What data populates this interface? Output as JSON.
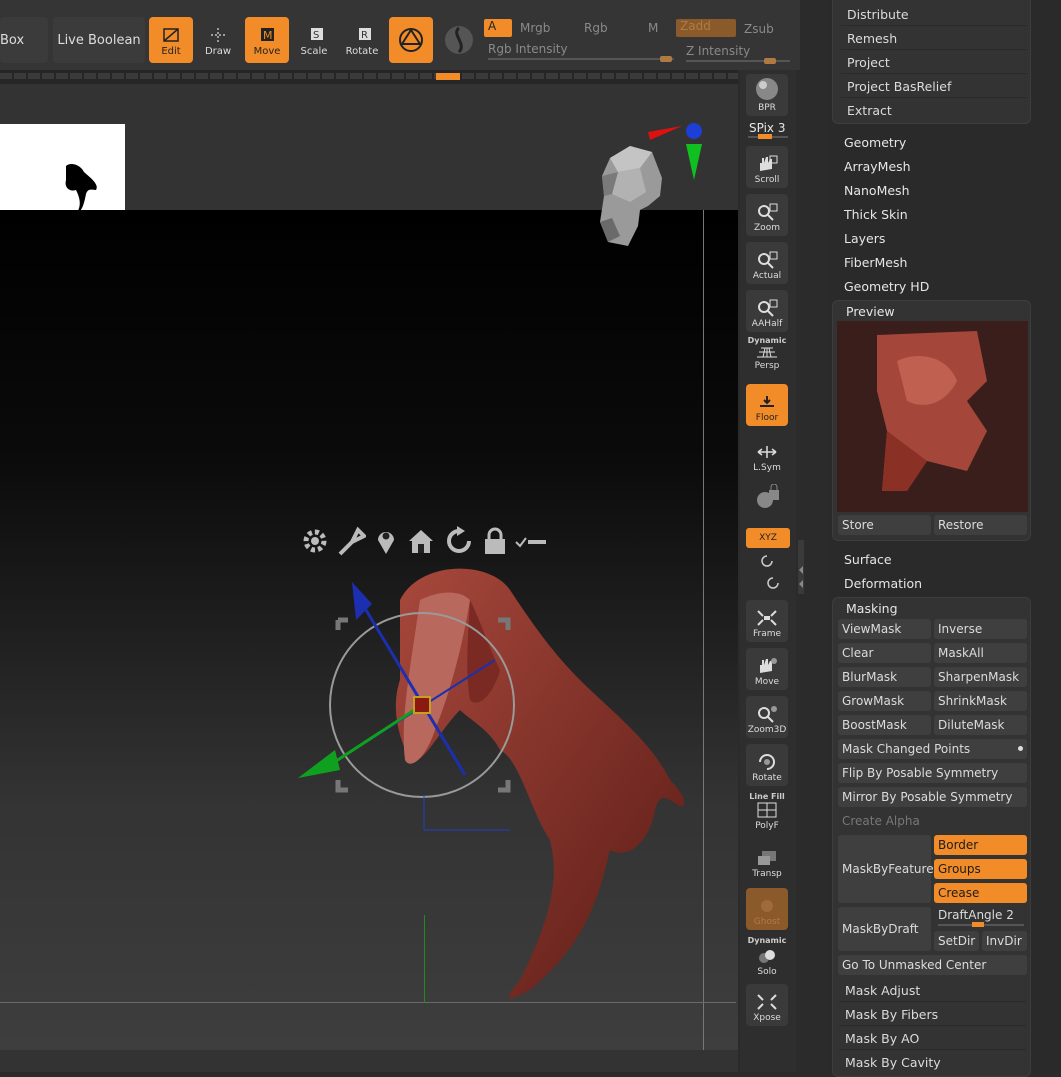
{
  "toolbar": {
    "box_label": "Box",
    "live_boolean_label": "Live Boolean",
    "tools": [
      {
        "label": "Edit",
        "active": true
      },
      {
        "label": "Draw",
        "active": false
      },
      {
        "label": "Move",
        "active": true
      },
      {
        "label": "Scale",
        "active": false
      },
      {
        "label": "Rotate",
        "active": false
      }
    ],
    "a_label": "A",
    "mrgb_label": "Mrgb",
    "rgb_label": "Rgb",
    "m_label": "M",
    "zadd_label": "Zadd",
    "zsub_label": "Zsub",
    "rgb_intensity_label": "Rgb Intensity",
    "z_intensity_label": "Z Intensity"
  },
  "shelf": {
    "bpr_label": "BPR",
    "spix_label": "SPix 3",
    "scroll_label": "Scroll",
    "zoom_label": "Zoom",
    "actual_label": "Actual",
    "aahalf_label": "AAHalf",
    "dynamic_label": "Dynamic",
    "persp_label": "Persp",
    "floor_label": "Floor",
    "lsym_label": "L.Sym",
    "xyz_label": "XYZ",
    "frame_label": "Frame",
    "move_label": "Move",
    "zoom3d_label": "Zoom3D",
    "rotate_label": "Rotate",
    "linefill_label": "Line Fill",
    "polyf_label": "PolyF",
    "transp_label": "Transp",
    "ghost_label": "Ghost",
    "dynamic2_label": "Dynamic",
    "solo_label": "Solo",
    "xpose_label": "Xpose"
  },
  "panel": {
    "top_items": [
      "Distribute",
      "Remesh",
      "Project",
      "Project BasRelief",
      "Extract"
    ],
    "sections": [
      "Geometry",
      "ArrayMesh",
      "NanoMesh",
      "Thick Skin",
      "Layers",
      "FiberMesh",
      "Geometry HD"
    ],
    "preview_label": "Preview",
    "store_label": "Store",
    "restore_label": "Restore",
    "surface_label": "Surface",
    "deformation_label": "Deformation",
    "masking_label": "Masking",
    "masking": {
      "viewmask": "ViewMask",
      "inverse": "Inverse",
      "clear": "Clear",
      "maskall": "MaskAll",
      "blurmask": "BlurMask",
      "sharpenmask": "SharpenMask",
      "growmask": "GrowMask",
      "shrinkmask": "ShrinkMask",
      "boostmask": "BoostMask",
      "dilutemask": "DiluteMask",
      "mask_changed_points": "Mask Changed Points",
      "flip_by_posable": "Flip By Posable Symmetry",
      "mirror_by_posable": "Mirror By Posable Symmetry",
      "create_alpha": "Create Alpha",
      "maskbyfeature": "MaskByFeature",
      "border": "Border",
      "groups": "Groups",
      "crease": "Crease",
      "maskbydraft": "MaskByDraft",
      "draftangle": "DraftAngle 2",
      "setdir": "SetDir",
      "invdir": "InvDir",
      "goto_unmasked": "Go To Unmasked Center",
      "mask_adjust": "Mask Adjust",
      "mask_by_fibers": "Mask By Fibers",
      "mask_by_ao": "Mask By AO",
      "mask_by_cavity": "Mask By Cavity"
    }
  }
}
